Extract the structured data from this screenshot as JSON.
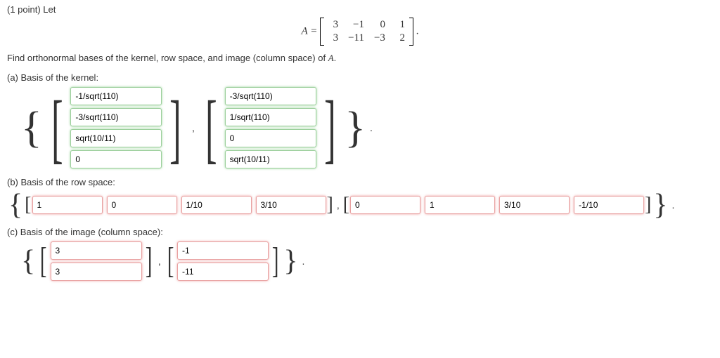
{
  "points_text": "(1 point) Let",
  "matrix": {
    "lhs": "A =",
    "rows": [
      [
        "3",
        "−1",
        "0",
        "1"
      ],
      [
        "3",
        "−11",
        "−3",
        "2"
      ]
    ],
    "trail": "."
  },
  "instruction_pre": "Find orthonormal bases of the kernel, row space, and image (column space) of ",
  "instruction_var": "A",
  "instruction_post": ".",
  "part_a": {
    "label": "(a) Basis of the kernel:",
    "vec1": [
      "-1/sqrt(110)",
      "-3/sqrt(110)",
      "sqrt(10/11)",
      "0"
    ],
    "vec2": [
      "-3/sqrt(110)",
      "1/sqrt(110)",
      "0",
      "sqrt(10/11)"
    ]
  },
  "part_b": {
    "label": "(b) Basis of the row space:",
    "vec1": [
      "1",
      "0",
      "1/10",
      "3/10"
    ],
    "vec2": [
      "0",
      "1",
      "3/10",
      "-1/10"
    ]
  },
  "part_c": {
    "label": "(c) Basis of the image (column space):",
    "vec1": [
      "3",
      "3"
    ],
    "vec2": [
      "-1",
      "-11"
    ]
  }
}
